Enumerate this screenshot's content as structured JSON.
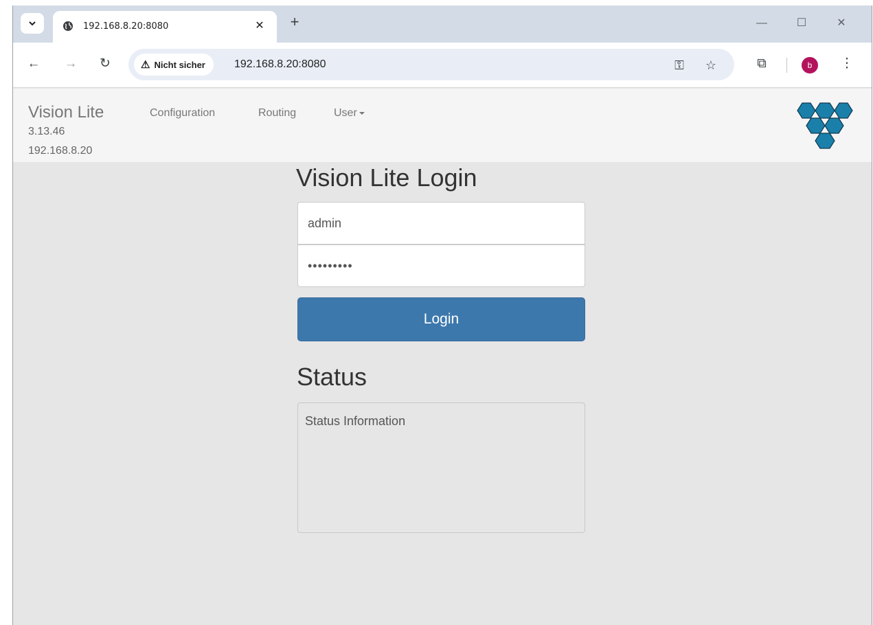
{
  "browser": {
    "tab": {
      "title": "192.168.8.20:8080",
      "favicon": "globe-icon"
    },
    "new_tab_label": "+",
    "security_label": "Nicht sicher",
    "url": "192.168.8.20:8080",
    "profile_initial": "b"
  },
  "navbar": {
    "brand": "Vision Lite",
    "version": "3.13.46",
    "ip": "192.168.8.20",
    "links": [
      "Configuration",
      "Routing",
      "User"
    ]
  },
  "login": {
    "title": "Vision Lite Login",
    "username_value": "admin",
    "password_value": "•••••••••",
    "button_label": "Login"
  },
  "status": {
    "title": "Status",
    "text": "Status Information"
  },
  "colors": {
    "button": "#3d78ad",
    "logo": "#1a80aa",
    "page_bg": "#e6e6e6"
  }
}
